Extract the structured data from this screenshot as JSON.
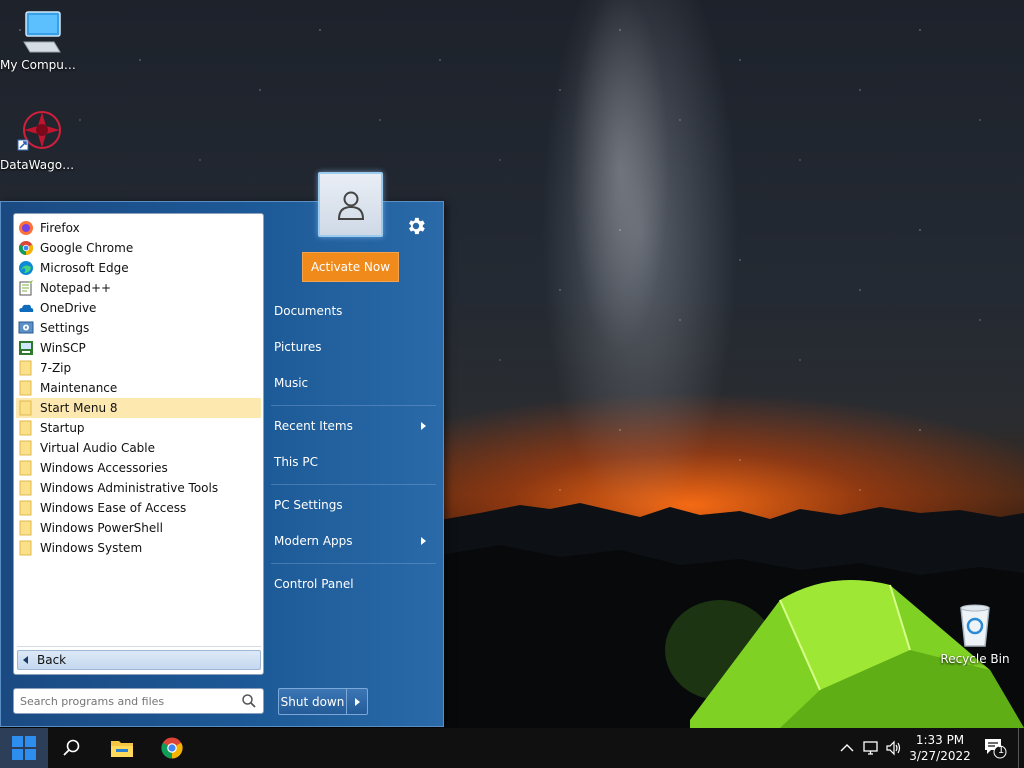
{
  "desktop": {
    "icons": [
      {
        "label": "My Computer",
        "icon": "computer-icon"
      },
      {
        "label": "DataWagon...",
        "icon": "datawagon-icon"
      },
      {
        "label": "Recycle Bin",
        "icon": "recycle-bin-icon"
      }
    ]
  },
  "start_menu": {
    "programs": [
      {
        "label": "Firefox",
        "icon": "firefox-icon"
      },
      {
        "label": "Google Chrome",
        "icon": "chrome-icon"
      },
      {
        "label": "Microsoft Edge",
        "icon": "edge-icon"
      },
      {
        "label": "Notepad++",
        "icon": "notepadpp-icon"
      },
      {
        "label": "OneDrive",
        "icon": "onedrive-icon"
      },
      {
        "label": "Settings",
        "icon": "settings-app-icon"
      },
      {
        "label": "WinSCP",
        "icon": "winscp-icon"
      },
      {
        "label": "7-Zip",
        "icon": "folder-icon"
      },
      {
        "label": "Maintenance",
        "icon": "folder-icon"
      },
      {
        "label": "Start Menu 8",
        "icon": "folder-icon",
        "selected": true
      },
      {
        "label": "Startup",
        "icon": "folder-icon"
      },
      {
        "label": "Virtual Audio Cable",
        "icon": "folder-icon"
      },
      {
        "label": "Windows Accessories",
        "icon": "folder-icon"
      },
      {
        "label": "Windows Administrative Tools",
        "icon": "folder-icon"
      },
      {
        "label": "Windows Ease of Access",
        "icon": "folder-icon"
      },
      {
        "label": "Windows PowerShell",
        "icon": "folder-icon"
      },
      {
        "label": "Windows System",
        "icon": "folder-icon"
      }
    ],
    "back_label": "Back",
    "search_placeholder": "Search programs and files",
    "activate_label": "Activate Now",
    "right_items": [
      {
        "label": "Documents",
        "submenu": false
      },
      {
        "label": "Pictures",
        "submenu": false
      },
      {
        "label": "Music",
        "submenu": false
      },
      {
        "label": "Recent Items",
        "submenu": true
      },
      {
        "label": "This PC",
        "submenu": false
      },
      {
        "label": "PC Settings",
        "submenu": false
      },
      {
        "label": "Modern Apps",
        "submenu": true
      },
      {
        "label": "Control Panel",
        "submenu": false
      }
    ],
    "shutdown_label": "Shut down"
  },
  "taskbar": {
    "time": "1:33 PM",
    "date": "3/27/2022",
    "notification_count": "1",
    "pinned": [
      "search-icon",
      "file-explorer-icon",
      "chrome-icon"
    ]
  },
  "colors": {
    "menu_blue": "#1d5a98",
    "activate_orange": "#f08a1b",
    "selected_item": "#fde9b0",
    "taskbar": "#101010"
  }
}
